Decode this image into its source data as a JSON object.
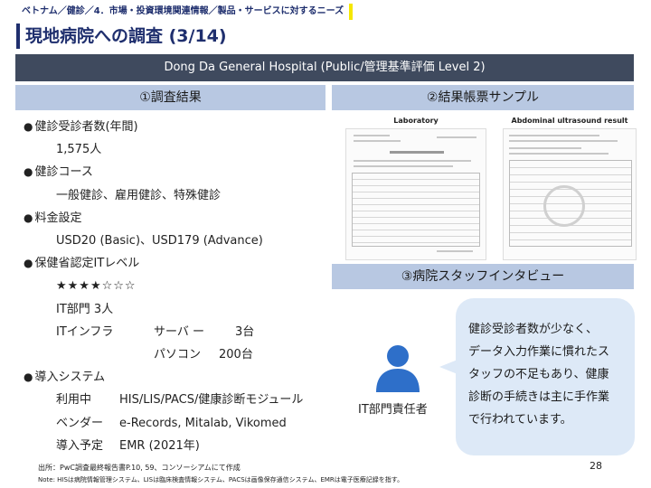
{
  "breadcrumb": "ベトナム／健診／4．市場・投資環境関連情報／製品・サービスに対するニーズ",
  "title": "現地病院への調査 (3/14)",
  "banner": "Dong Da General Hospital (Public/管理基準評価 Level 2)",
  "sections": {
    "results": "①調査結果",
    "samples": "②結果帳票サンプル",
    "interview": "③病院スタッフインタビュー"
  },
  "results": {
    "patients_label": "健診受診者数(年間)",
    "patients_value": "1,575人",
    "course_label": "健診コース",
    "course_value": "一般健診、雇用健診、特殊健診",
    "price_label": "料金設定",
    "price_value": "USD20 (Basic)、USD179 (Advance)",
    "it_level_label": "保健省認定ITレベル",
    "it_stars": "★★★★☆☆☆",
    "it_dept": "IT部門  3人",
    "infra_label": "ITインフラ",
    "server_label": "サーバ ー",
    "server_value": "3台",
    "pc_label": "パソコン",
    "pc_value": "200台",
    "system_label": "導入システム",
    "in_use_label": "利用中",
    "in_use_value": "HIS/LIS/PACS/健康診断モジュール",
    "vendor_label": "ベンダー",
    "vendor_value": "e-Records, Mitalab, Vikomed",
    "planned_label": "導入予定",
    "planned_value": "EMR (2021年)"
  },
  "samples": {
    "lab_title": "Laboratory",
    "abd_title": "Abdominal ultrasound result"
  },
  "interview": {
    "person_label": "IT部門責任者",
    "quote_lines": [
      "健診受診者数が少なく、",
      "データ入力作業に慣れたス",
      "タッフの不足もあり、健康",
      "診断の手続きは主に手作業",
      "で行われています。"
    ]
  },
  "footer": {
    "source": "出所：PwC調査最終報告書P.10, 59、コンソーシアムにて作成",
    "note": "Note: HISは病院情報管理システム、LISは臨床検査情報システム、PACSは画像保存通信システム、EMRは電子医療記録を指す。",
    "page": "28"
  },
  "colors": {
    "navy": "#1f2f6e",
    "banner": "#3f4a5e",
    "section": "#b8c8e2",
    "bubble": "#dde9f7",
    "person": "#2e6fc9",
    "accent_yellow": "#f5e700"
  }
}
